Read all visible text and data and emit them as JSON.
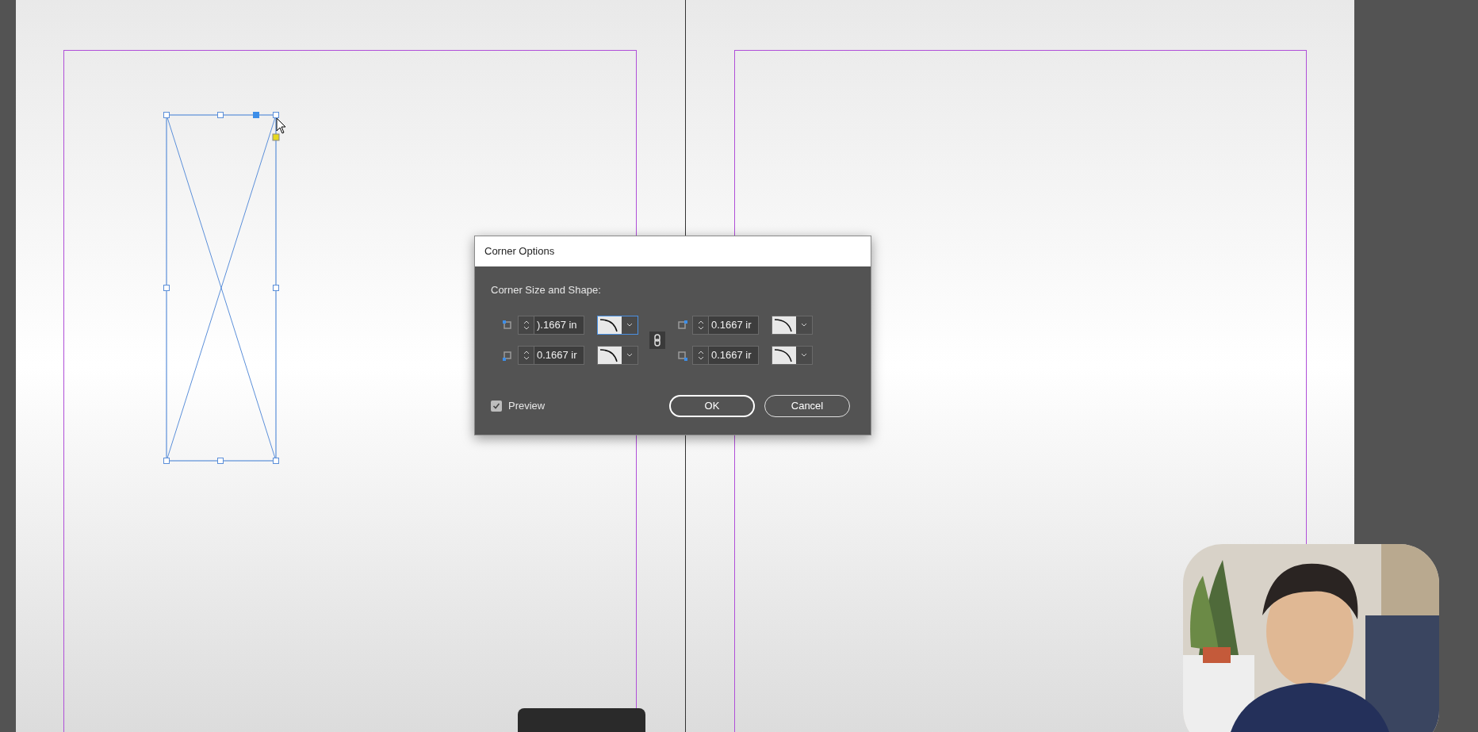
{
  "dialog": {
    "title": "Corner Options",
    "section_label": "Corner Size and Shape:",
    "corners": [
      {
        "kind": "top-left",
        "value": ").1667 in",
        "focused": true
      },
      {
        "kind": "top-right",
        "value": "0.1667 ir",
        "focused": false
      },
      {
        "kind": "bottom-left",
        "value": "0.1667 ir",
        "focused": false
      },
      {
        "kind": "bottom-right",
        "value": "0.1667 ir",
        "focused": false
      }
    ],
    "preview": {
      "label": "Preview",
      "checked": true
    },
    "buttons": [
      "OK",
      "Cancel"
    ]
  }
}
